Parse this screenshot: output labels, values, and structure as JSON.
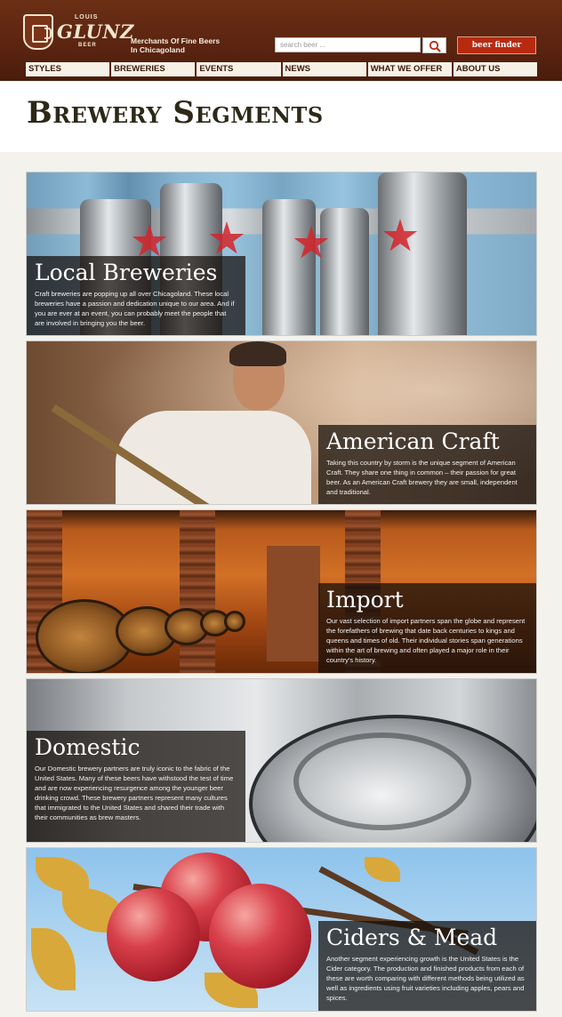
{
  "header": {
    "logo": {
      "top_text": "LOUIS",
      "name": "GLUNZ",
      "bottom_text": "BEER"
    },
    "tagline": "Merchants Of Fine Beers In Chicagoland",
    "search": {
      "placeholder": "search beer ..."
    },
    "beer_finder_label": "beer finder",
    "accent_color": "#b82a10",
    "nav": [
      {
        "label": "STYLES"
      },
      {
        "label": "BREWERIES"
      },
      {
        "label": "EVENTS"
      },
      {
        "label": "NEWS"
      },
      {
        "label": "WHAT WE OFFER"
      },
      {
        "label": "ABOUT US"
      }
    ]
  },
  "page": {
    "title": "Brewery Segments"
  },
  "segments": [
    {
      "title": "Local Breweries",
      "description": "Craft breweries are popping up all over Chicagoland. These local breweries have a passion and dedication unique to our area. And if you are ever at an event, you can probably meet the people that are involved in bringing you the beer."
    },
    {
      "title": "American Craft",
      "description": "Taking this country by storm is the unique segment of American Craft. They share one thing in common – their passion for great beer. As an American Craft brewery they are small, independent and traditional."
    },
    {
      "title": "Import",
      "description": "Our vast selection of import partners span the globe and represent the forefathers of brewing that date back centuries to kings and queens and times of old. Their individual stories span generations within the art of brewing and often played a major role in their country's history."
    },
    {
      "title": "Domestic",
      "description": "Our Domestic brewery partners are truly iconic to the fabric of the United States. Many of these beers have withstood the test of time and are now experiencing resurgence among the younger beer drinking crowd. These brewery partners represent many cultures that immigrated to the United States and shared their trade with their communities as brew masters."
    },
    {
      "title": "Ciders & Mead",
      "description": "Another segment experiencing growth is the United States is the Cider category. The production and finished products from each of these are worth comparing with different methods being utilized as well as ingredients using fruit varieties including apples, pears and spices."
    }
  ]
}
